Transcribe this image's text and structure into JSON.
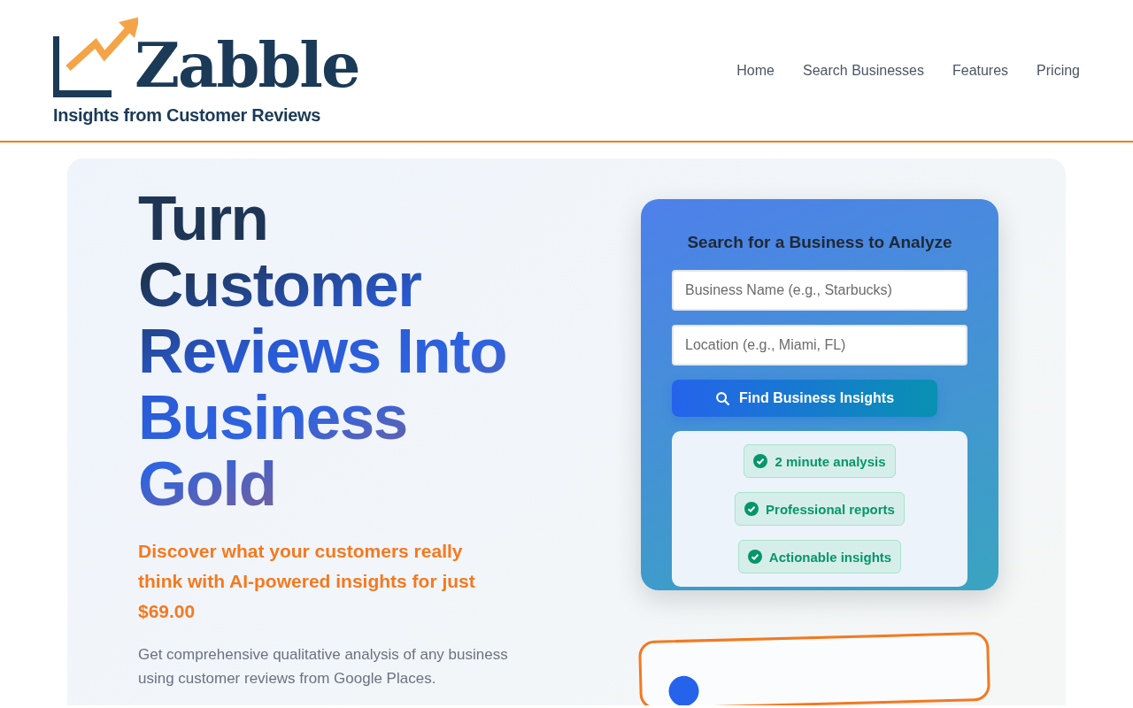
{
  "header": {
    "logo": {
      "name": "Zabble",
      "tagline": "Insights from Customer Reviews"
    },
    "nav": [
      {
        "label": "Home"
      },
      {
        "label": "Search Businesses"
      },
      {
        "label": "Features"
      },
      {
        "label": "Pricing"
      }
    ]
  },
  "hero": {
    "headline": "Turn Customer Reviews Into Business Gold",
    "subheadline": "Discover what your customers really think with AI-powered insights for just $69.00",
    "description": "Get comprehensive qualitative analysis of any business using customer reviews from Google Places."
  },
  "search_card": {
    "title": "Search for a Business to Analyze",
    "fields": [
      {
        "placeholder": "Business Name (e.g., Starbucks)"
      },
      {
        "placeholder": "Location (e.g., Miami, FL)"
      }
    ],
    "button": "Find Business Insights",
    "features": [
      "2 minute analysis",
      "Professional reports",
      "Actionable insights"
    ]
  }
}
